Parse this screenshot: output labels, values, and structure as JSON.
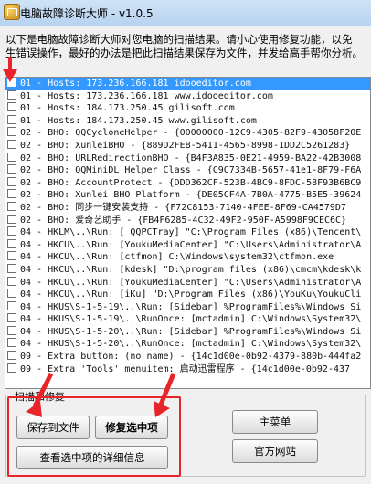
{
  "window": {
    "title": "电脑故障诊断大师 - v1.0.5"
  },
  "intro": {
    "line1": "以下是电脑故障诊断大师对您电脑的扫描结果。请小心使用修复功能，以免",
    "line2": "生错误操作，最好的办法是把此扫描结果保存为文件，并发给高手帮你分析。"
  },
  "results": [
    "01 - Hosts: 173.236.166.181 idooeditor.com",
    "01 - Hosts: 173.236.166.181 www.idooeditor.com",
    "01 - Hosts: 184.173.250.45 gilisoft.com",
    "01 - Hosts: 184.173.250.45 www.gilisoft.com",
    "02 - BHO: QQCycloneHelper - {00000000-12C9-4305-82F9-43058F20E",
    "02 - BHO: XunleiBHO - {889D2FEB-5411-4565-8998-1DD2C5261283}",
    "02 - BHO: URLRedirectionBHO - {B4F3A835-0E21-4959-BA22-42B3008",
    "02 - BHO: QQMiniDL Helper Class - {C9C7334B-5657-41e1-8F79-F6A",
    "02 - BHO: AccountProtect - {DDD362CF-523B-4BC9-8FDC-58F93B6BC9",
    "02 - BHO: Xunlei BHO Platform - {DE05CF4A-7B0A-4775-B5E5-39624",
    "02 - BHO: 同步一键安装支持 - {F72C8153-7140-4FEE-8F69-CA4579D7",
    "02 - BHO: 爱奇艺助手 - {FB4F6285-4C32-49F2-950F-A5998F9CEC6C}",
    "04 - HKLM\\..\\Run: [ QQPCTray] \"C:\\Program Files (x86)\\Tencent\\",
    "04 - HKCU\\..\\Run: [YoukuMediaCenter] \"C:\\Users\\Administrator\\A",
    "04 - HKCU\\..\\Run: [ctfmon] C:\\Windows\\system32\\ctfmon.exe",
    "04 - HKCU\\..\\Run: [kdesk] \"D:\\program files (x86)\\cmcm\\kdesk\\k",
    "04 - HKCU\\..\\Run: [YoukuMediaCenter] \"C:\\Users\\Administrator\\A",
    "04 - HKCU\\..\\Run: [iKu] \"D:\\Program Files (x86)\\YouKu\\YoukuCli",
    "04 - HKUS\\S-1-5-19\\..\\Run: [Sidebar] %ProgramFiles%\\Windows Si",
    "04 - HKUS\\S-1-5-19\\..\\RunOnce: [mctadmin] C:\\Windows\\System32\\",
    "04 - HKUS\\S-1-5-20\\..\\Run: [Sidebar] %ProgramFiles%\\Windows Si",
    "04 - HKUS\\S-1-5-20\\..\\RunOnce: [mctadmin] C:\\Windows\\System32\\",
    "09 - Extra button: (no name) - {14c1d00e-0b92-4379-880b-444fa2",
    "09 - Extra 'Tools' menuitem: 启动迅雷程序 - {14c1d00e-0b92-437"
  ],
  "selected_index": 0,
  "group": {
    "label": "扫描和修复"
  },
  "buttons": {
    "save": "保存到文件",
    "repair": "修复选中项",
    "details": "查看选中项的详细信息",
    "main_menu": "主菜单",
    "website": "官方网站"
  },
  "annotation_color": "#e8242b"
}
